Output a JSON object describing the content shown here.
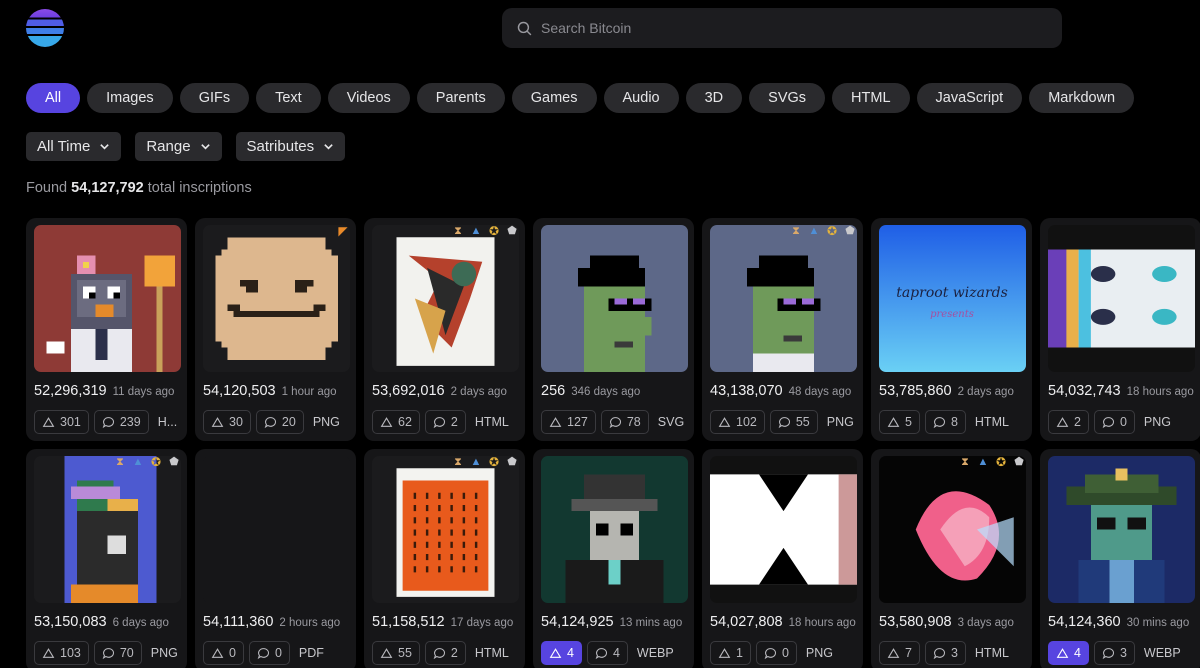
{
  "header": {
    "logo": "ordinals-logo",
    "search_placeholder": "Search Bitcoin"
  },
  "filters": [
    "All",
    "Images",
    "GIFs",
    "Text",
    "Videos",
    "Parents",
    "Games",
    "Audio",
    "3D",
    "SVGs",
    "HTML",
    "JavaScript",
    "Markdown"
  ],
  "active_filter": "All",
  "dropdowns": [
    "All Time",
    "Range",
    "Satributes"
  ],
  "found": {
    "prefix": "Found",
    "count": "54,127,792",
    "suffix": "total inscriptions"
  },
  "accent_color": "#5744e0",
  "cards": [
    {
      "number": "52,296,319",
      "age": "11 days ago",
      "likes": "301",
      "comments": "239",
      "type": "H...",
      "badges": [],
      "liked": false
    },
    {
      "number": "54,120,503",
      "age": "1 hour ago",
      "likes": "30",
      "comments": "20",
      "type": "PNG",
      "badges": [
        "pizza"
      ],
      "liked": false
    },
    {
      "number": "53,692,016",
      "age": "2 days ago",
      "likes": "62",
      "comments": "2",
      "type": "HTML",
      "badges": [
        "hourglass",
        "gnome",
        "award",
        "shield"
      ],
      "liked": false
    },
    {
      "number": "256",
      "age": "346 days ago",
      "likes": "127",
      "comments": "78",
      "type": "SVG",
      "badges": [],
      "liked": false
    },
    {
      "number": "43,138,070",
      "age": "48 days ago",
      "likes": "102",
      "comments": "55",
      "type": "PNG",
      "badges": [
        "hourglass",
        "gnome",
        "award",
        "shield"
      ],
      "liked": false
    },
    {
      "number": "53,785,860",
      "age": "2 days ago",
      "likes": "5",
      "comments": "8",
      "type": "HTML",
      "badges": [],
      "liked": false
    },
    {
      "number": "54,032,743",
      "age": "18 hours ago",
      "likes": "2",
      "comments": "0",
      "type": "PNG",
      "badges": [],
      "liked": false
    },
    {
      "number": "53,150,083",
      "age": "6 days ago",
      "likes": "103",
      "comments": "70",
      "type": "PNG",
      "badges": [
        "hourglass",
        "gnome",
        "award",
        "shield"
      ],
      "liked": false
    },
    {
      "number": "54,111,360",
      "age": "2 hours ago",
      "likes": "0",
      "comments": "0",
      "type": "PDF",
      "badges": [],
      "liked": false
    },
    {
      "number": "51,158,512",
      "age": "17 days ago",
      "likes": "55",
      "comments": "2",
      "type": "HTML",
      "badges": [
        "hourglass",
        "gnome",
        "award",
        "shield"
      ],
      "liked": false
    },
    {
      "number": "54,124,925",
      "age": "13 mins ago",
      "likes": "4",
      "comments": "4",
      "type": "WEBP",
      "badges": [],
      "liked": true
    },
    {
      "number": "54,027,808",
      "age": "18 hours ago",
      "likes": "1",
      "comments": "0",
      "type": "PNG",
      "badges": [],
      "liked": false
    },
    {
      "number": "53,580,908",
      "age": "3 days ago",
      "likes": "7",
      "comments": "3",
      "type": "HTML",
      "badges": [
        "hourglass",
        "gnome",
        "award",
        "shield"
      ],
      "liked": false
    },
    {
      "number": "54,124,360",
      "age": "30 mins ago",
      "likes": "4",
      "comments": "3",
      "type": "WEBP",
      "badges": [],
      "liked": true
    }
  ],
  "thumb_text": {
    "taproot": "taproot wizards",
    "presents": "presents"
  }
}
